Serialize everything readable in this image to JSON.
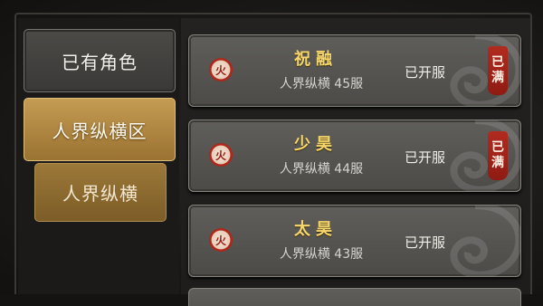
{
  "nav": {
    "owned_label": "已有角色",
    "zone_label": "人界纵横区",
    "sub_label": "人界纵横"
  },
  "servers": [
    {
      "name": "祝融",
      "sub": "人界纵横 45服",
      "status": "已开服",
      "element": "火",
      "full_stamp": [
        "已",
        "满"
      ]
    },
    {
      "name": "少昊",
      "sub": "人界纵横 44服",
      "status": "已开服",
      "element": "火",
      "full_stamp": [
        "已",
        "满"
      ]
    },
    {
      "name": "太昊",
      "sub": "人界纵横 43服",
      "status": "已开服",
      "element": "火",
      "full_stamp": []
    }
  ],
  "colors": {
    "gold_accent": "#c59c52",
    "server_name": "#f5d76e",
    "stamp_red": "#b22a20"
  }
}
